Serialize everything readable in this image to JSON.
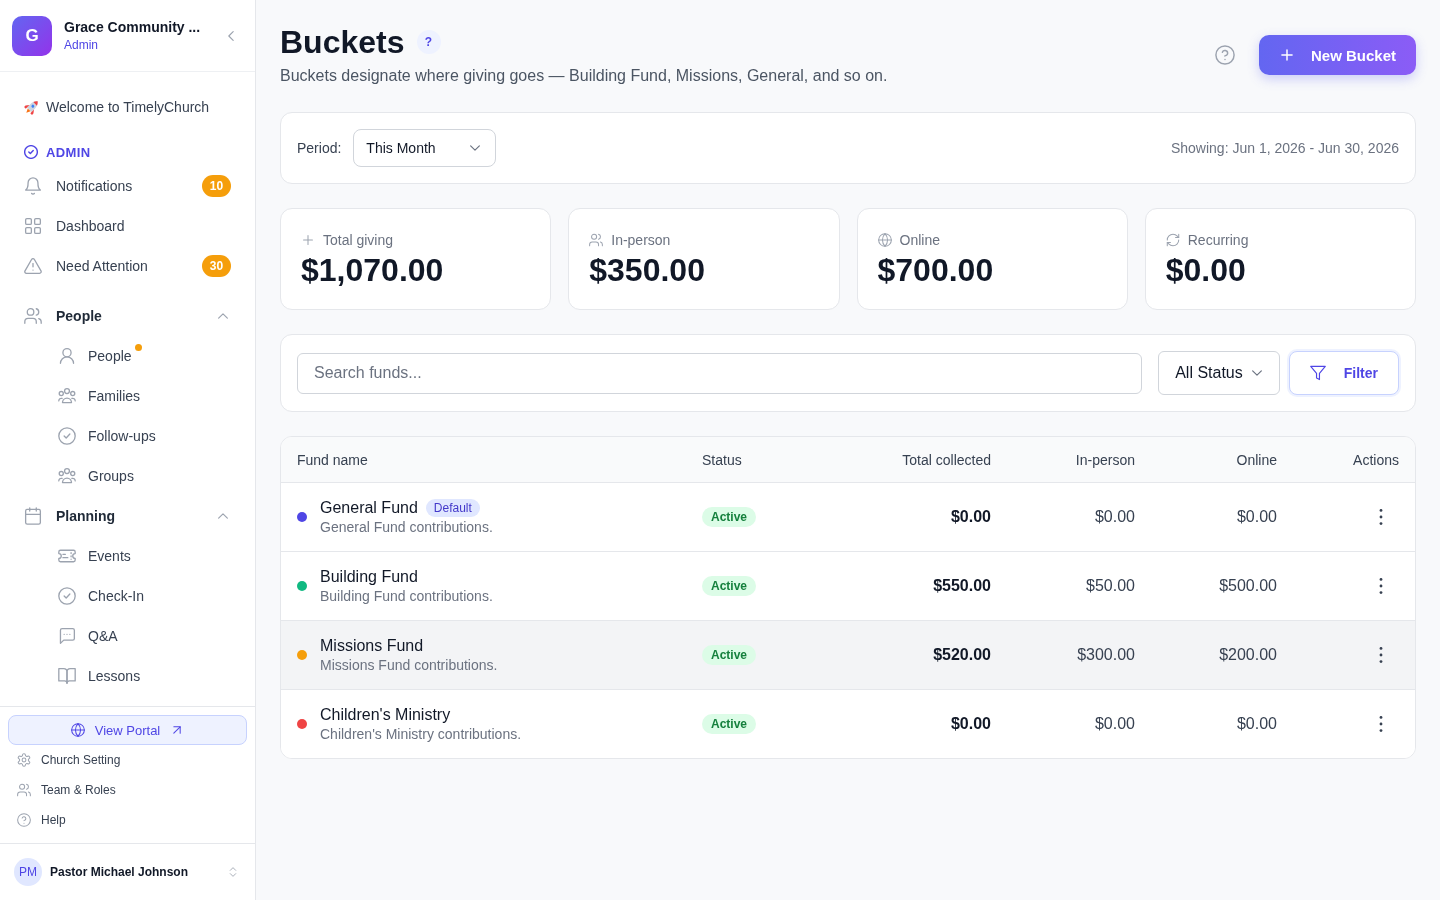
{
  "sidebar": {
    "org": {
      "initial": "G",
      "name": "Grace Community ...",
      "role": "Admin"
    },
    "welcome": "Welcome to TimelyChurch",
    "section_label": "ADMIN",
    "nav": [
      {
        "kind": "link",
        "label": "Notifications",
        "badge": "10"
      },
      {
        "kind": "link",
        "label": "Dashboard"
      },
      {
        "kind": "link",
        "label": "Need Attention",
        "badge": "30"
      },
      {
        "kind": "group",
        "label": "People",
        "expanded": true,
        "children": [
          {
            "label": "People",
            "unread": true
          },
          {
            "label": "Families",
            "unread": false
          },
          {
            "label": "Follow-ups",
            "unread": false
          },
          {
            "label": "Groups",
            "unread": false
          }
        ]
      },
      {
        "kind": "group",
        "label": "Planning",
        "expanded": true,
        "children": [
          {
            "label": "Events",
            "unread": false
          },
          {
            "label": "Check-In",
            "unread": false
          },
          {
            "label": "Q&A",
            "unread": false
          },
          {
            "label": "Lessons",
            "unread": false
          }
        ]
      }
    ],
    "portal_button": "View Portal",
    "footer_links": [
      "Church Setting",
      "Team & Roles",
      "Help"
    ],
    "user": {
      "initials": "PM",
      "name": "Pastor Michael Johnson"
    }
  },
  "header": {
    "title": "Buckets",
    "help_badge": "?",
    "subtitle": "Buckets designate where giving goes — Building Fund, Missions, General, and so on.",
    "button": "New Bucket"
  },
  "period": {
    "label": "Period:",
    "value": "This Month",
    "range": "Showing: Jun 1, 2026 - Jun 30, 2026"
  },
  "stats": [
    {
      "label": "Total giving",
      "value": "$1,070.00"
    },
    {
      "label": "In-person",
      "value": "$350.00"
    },
    {
      "label": "Online",
      "value": "$700.00"
    },
    {
      "label": "Recurring",
      "value": "$0.00"
    }
  ],
  "filters": {
    "search_placeholder": "Search funds...",
    "status": "All Status",
    "button": "Filter"
  },
  "table": {
    "columns": [
      "Fund name",
      "Status",
      "Total collected",
      "In-person",
      "Online",
      "Actions"
    ],
    "rows": [
      {
        "color": "#4f46e5",
        "name": "General Fund",
        "badge": "Default",
        "description": "General Fund contributions.",
        "status": "Active",
        "total": "$0.00",
        "in_person": "$0.00",
        "online": "$0.00",
        "highlighted": false
      },
      {
        "color": "#10b981",
        "name": "Building Fund",
        "description": "Building Fund contributions.",
        "status": "Active",
        "total": "$550.00",
        "in_person": "$50.00",
        "online": "$500.00",
        "highlighted": false
      },
      {
        "color": "#f59e0b",
        "name": "Missions Fund",
        "description": "Missions Fund contributions.",
        "status": "Active",
        "total": "$520.00",
        "in_person": "$300.00",
        "online": "$200.00",
        "highlighted": true
      },
      {
        "color": "#ef4444",
        "name": "Children's Ministry",
        "description": "Children's Ministry contributions.",
        "status": "Active",
        "total": "$0.00",
        "in_person": "$0.00",
        "online": "$0.00",
        "highlighted": false
      }
    ]
  }
}
